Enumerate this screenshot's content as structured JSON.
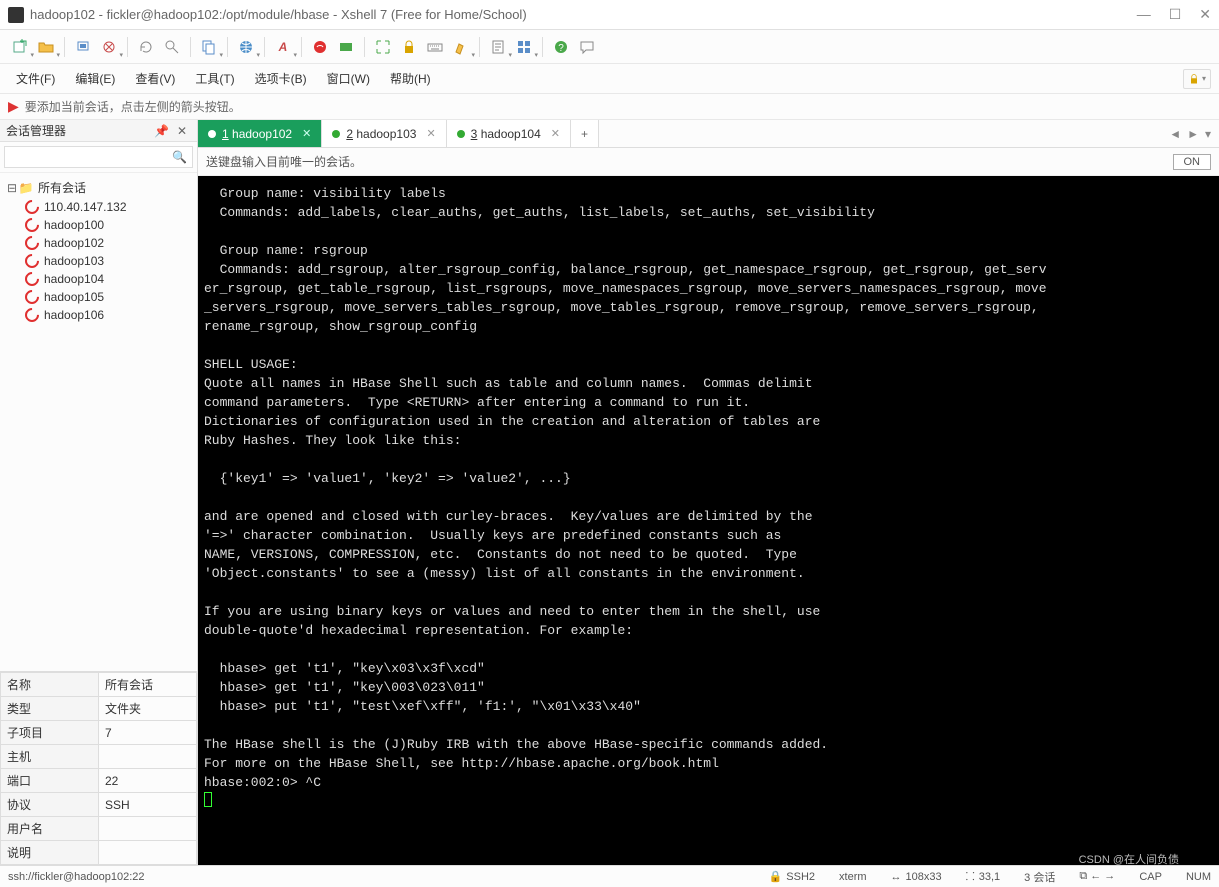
{
  "window": {
    "title": "hadoop102 - fickler@hadoop102:/opt/module/hbase - Xshell 7 (Free for Home/School)",
    "minimize": "—",
    "maximize": "☐",
    "close": "✕"
  },
  "menu": {
    "file": "文件(F)",
    "edit": "编辑(E)",
    "view": "查看(V)",
    "tools": "工具(T)",
    "tabs": "选项卡(B)",
    "window": "窗口(W)",
    "help": "帮助(H)"
  },
  "hint": "要添加当前会话，点击左侧的箭头按钮。",
  "sidebar": {
    "header": "会话管理器",
    "search_placeholder": "",
    "root": "所有会话",
    "items": [
      {
        "label": "110.40.147.132"
      },
      {
        "label": "hadoop100"
      },
      {
        "label": "hadoop102"
      },
      {
        "label": "hadoop103"
      },
      {
        "label": "hadoop104"
      },
      {
        "label": "hadoop105"
      },
      {
        "label": "hadoop106"
      }
    ]
  },
  "props": {
    "h1": "名称",
    "v1": "所有会话",
    "h2": "类型",
    "v2": "文件夹",
    "h3": "子项目",
    "v3": "7",
    "h4": "主机",
    "v4": "",
    "h5": "端口",
    "v5": "22",
    "h6": "协议",
    "v6": "SSH",
    "h7": "用户名",
    "v7": "",
    "h8": "说明",
    "v8": ""
  },
  "tabs": [
    {
      "num": "1",
      "label": "hadoop102",
      "active": true
    },
    {
      "num": "2",
      "label": "hadoop103",
      "active": false
    },
    {
      "num": "3",
      "label": "hadoop104",
      "active": false
    }
  ],
  "tabadd": "+",
  "infobar": {
    "text": "送键盘输入目前唯一的会话。",
    "btn": "ON"
  },
  "terminal": "  Group name: visibility labels\n  Commands: add_labels, clear_auths, get_auths, list_labels, set_auths, set_visibility\n\n  Group name: rsgroup\n  Commands: add_rsgroup, alter_rsgroup_config, balance_rsgroup, get_namespace_rsgroup, get_rsgroup, get_serv\ner_rsgroup, get_table_rsgroup, list_rsgroups, move_namespaces_rsgroup, move_servers_namespaces_rsgroup, move\n_servers_rsgroup, move_servers_tables_rsgroup, move_tables_rsgroup, remove_rsgroup, remove_servers_rsgroup, \nrename_rsgroup, show_rsgroup_config\n\nSHELL USAGE:\nQuote all names in HBase Shell such as table and column names.  Commas delimit\ncommand parameters.  Type <RETURN> after entering a command to run it.\nDictionaries of configuration used in the creation and alteration of tables are\nRuby Hashes. They look like this:\n\n  {'key1' => 'value1', 'key2' => 'value2', ...}\n\nand are opened and closed with curley-braces.  Key/values are delimited by the\n'=>' character combination.  Usually keys are predefined constants such as\nNAME, VERSIONS, COMPRESSION, etc.  Constants do not need to be quoted.  Type\n'Object.constants' to see a (messy) list of all constants in the environment.\n\nIf you are using binary keys or values and need to enter them in the shell, use\ndouble-quote'd hexadecimal representation. For example:\n\n  hbase> get 't1', \"key\\x03\\x3f\\xcd\"\n  hbase> get 't1', \"key\\003\\023\\011\"\n  hbase> put 't1', \"test\\xef\\xff\", 'f1:', \"\\x01\\x33\\x40\"\n\nThe HBase shell is the (J)Ruby IRB with the above HBase-specific commands added.\nFor more on the HBase Shell, see http://hbase.apache.org/book.html\nhbase:002:0> ^C",
  "status": {
    "conn": "ssh://fickler@hadoop102:22",
    "proto": "SSH2",
    "term": "xterm",
    "size": "108x33",
    "pos": "33,1",
    "sessions": "3 会话",
    "cap": "CAP",
    "num": "NUM",
    "watermark": "CSDN @在人间负债"
  }
}
